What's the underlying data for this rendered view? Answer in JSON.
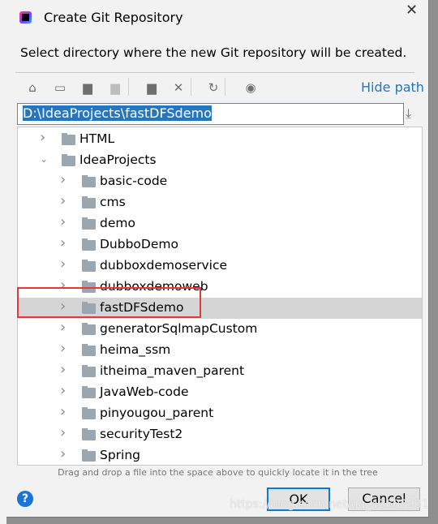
{
  "dialog": {
    "title": "Create Git Repository",
    "description": "Select directory where the new Git repository will be created.",
    "close_icon": "close-icon"
  },
  "toolbar": {
    "icons": [
      "home-icon",
      "desktop-icon",
      "project-folder-icon",
      "module-folder-icon",
      "new-folder-icon",
      "delete-icon",
      "refresh-icon",
      "show-hidden-icon"
    ],
    "hide_path": "Hide path"
  },
  "path": {
    "value": "D:\\IdeaProjects\\fastDFSdemo"
  },
  "tree": {
    "items": [
      {
        "label": "HTML",
        "level": 0,
        "expanded": false
      },
      {
        "label": "IdeaProjects",
        "level": 0,
        "expanded": true
      },
      {
        "label": "basic-code",
        "level": 1
      },
      {
        "label": "cms",
        "level": 1
      },
      {
        "label": "demo",
        "level": 1
      },
      {
        "label": "DubboDemo",
        "level": 1
      },
      {
        "label": "dubboxdemoservice",
        "level": 1
      },
      {
        "label": "dubboxdemoweb",
        "level": 1
      },
      {
        "label": "fastDFSdemo",
        "level": 1,
        "selected": true
      },
      {
        "label": "generatorSqlmapCustom",
        "level": 1
      },
      {
        "label": "heima_ssm",
        "level": 1
      },
      {
        "label": "itheima_maven_parent",
        "level": 1
      },
      {
        "label": "JavaWeb-code",
        "level": 1
      },
      {
        "label": "pinyougou_parent",
        "level": 1
      },
      {
        "label": "securityTest2",
        "level": 1
      },
      {
        "label": "Spring",
        "level": 1
      }
    ]
  },
  "hint": "Drag and drop a file into the space above to quickly locate it in the tree",
  "buttons": {
    "ok": "OK",
    "cancel": "Cancel"
  },
  "watermark": "https://blog.csdn.net/qq_43603931",
  "colors": {
    "accent": "#2675bf",
    "highlight": "#e03a3a",
    "selection": "#d5d5d5"
  }
}
